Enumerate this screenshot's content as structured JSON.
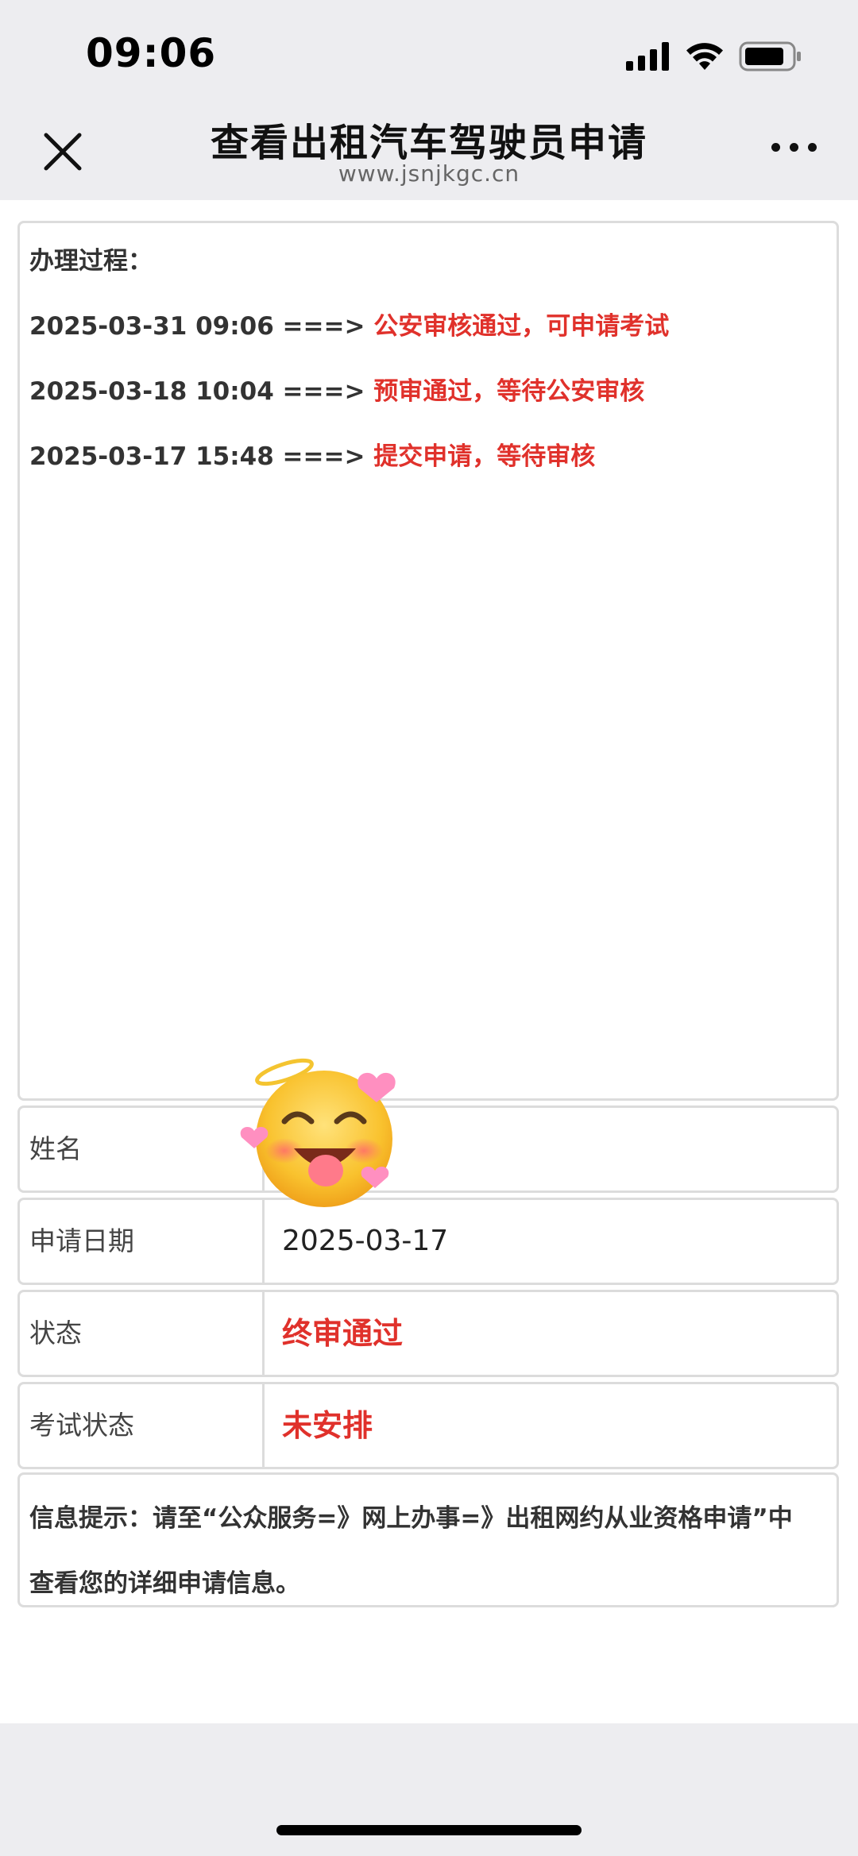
{
  "status_bar": {
    "time": "09:06",
    "icons": [
      "signal-icon",
      "wifi-icon",
      "battery-icon"
    ]
  },
  "nav": {
    "title": "查看出租汽车驾驶员申请",
    "subtitle": "www.jsnjkgc.cn",
    "close_icon": "close-icon",
    "more_icon": "more-icon"
  },
  "process": {
    "title": "办理过程：",
    "entries": [
      {
        "timestamp": "2025-03-31 09:06 ===>",
        "message": "公安审核通过，可申请考试"
      },
      {
        "timestamp": "2025-03-18 10:04 ===>",
        "message": "预审通过，等待公安审核"
      },
      {
        "timestamp": "2025-03-17 15:48 ===>",
        "message": "提交申请，等待审核"
      }
    ]
  },
  "fields": [
    {
      "label": "姓名",
      "value": ""
    },
    {
      "label": "申请日期",
      "value": "2025-03-17"
    },
    {
      "label": "状态",
      "value": "终审通过"
    },
    {
      "label": "考试状态",
      "value": "未安排"
    }
  ],
  "notice": {
    "line1": "信息提示：请至“公众服务=》网上办事=》出租网约从业资格申请”中",
    "line2": "查看您的详细申请信息。"
  },
  "colors": {
    "highlight_red": "#e0312b",
    "background": "#ededf0",
    "border": "#dcdcdc"
  },
  "sticker_icon": "smiling-face-with-hearts-halo-sticker"
}
